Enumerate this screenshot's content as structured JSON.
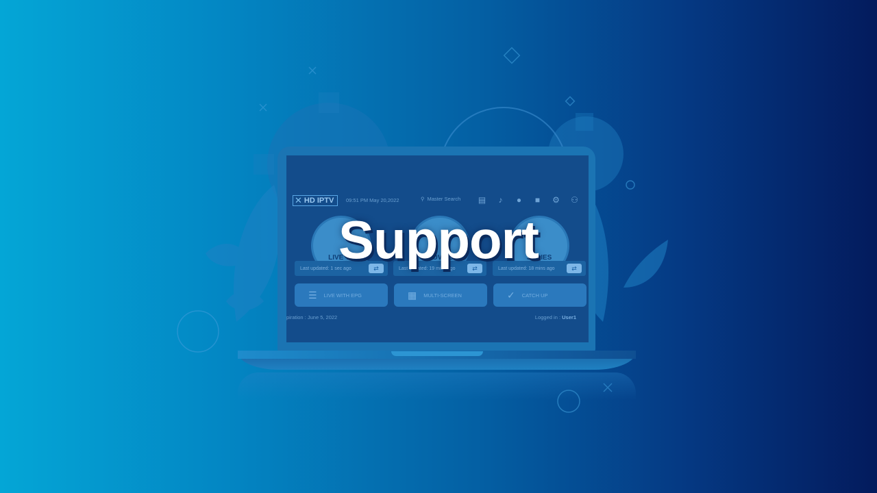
{
  "page": {
    "title": "Support"
  },
  "device_screen": {
    "logo_text": "HD IPTV",
    "logo_icon": "x-logo-icon",
    "datetime": "09:51 PM  May 20,2022",
    "search_label": "Master Search",
    "top_icons": [
      "radio-icon",
      "bell-icon",
      "user-icon",
      "video-icon",
      "gear-icon",
      "switch-user-icon"
    ],
    "cards": [
      {
        "label": "LIVE TV",
        "updated": "Last updated: 1 sec ago",
        "icon": "tv-icon"
      },
      {
        "label": "MOVIES",
        "updated": "Last updated: 19 mins ago",
        "icon": "film-icon"
      },
      {
        "label": "SERIES",
        "updated": "Last updated: 18 mins ago",
        "icon": "series-icon"
      }
    ],
    "actions": [
      {
        "label": "LIVE WITH EPG",
        "icon": "list-icon"
      },
      {
        "label": "MULTI-SCREEN",
        "icon": "grid-icon"
      },
      {
        "label": "CATCH UP",
        "icon": "check-circle-icon"
      }
    ],
    "expiration": "piration : June 5, 2022",
    "logged_in_label": "Logged in :",
    "logged_in_user": "User1"
  },
  "colors": {
    "gradient_left": "#04a6d6",
    "gradient_right": "#031b5d",
    "title_color": "#ffffff"
  }
}
